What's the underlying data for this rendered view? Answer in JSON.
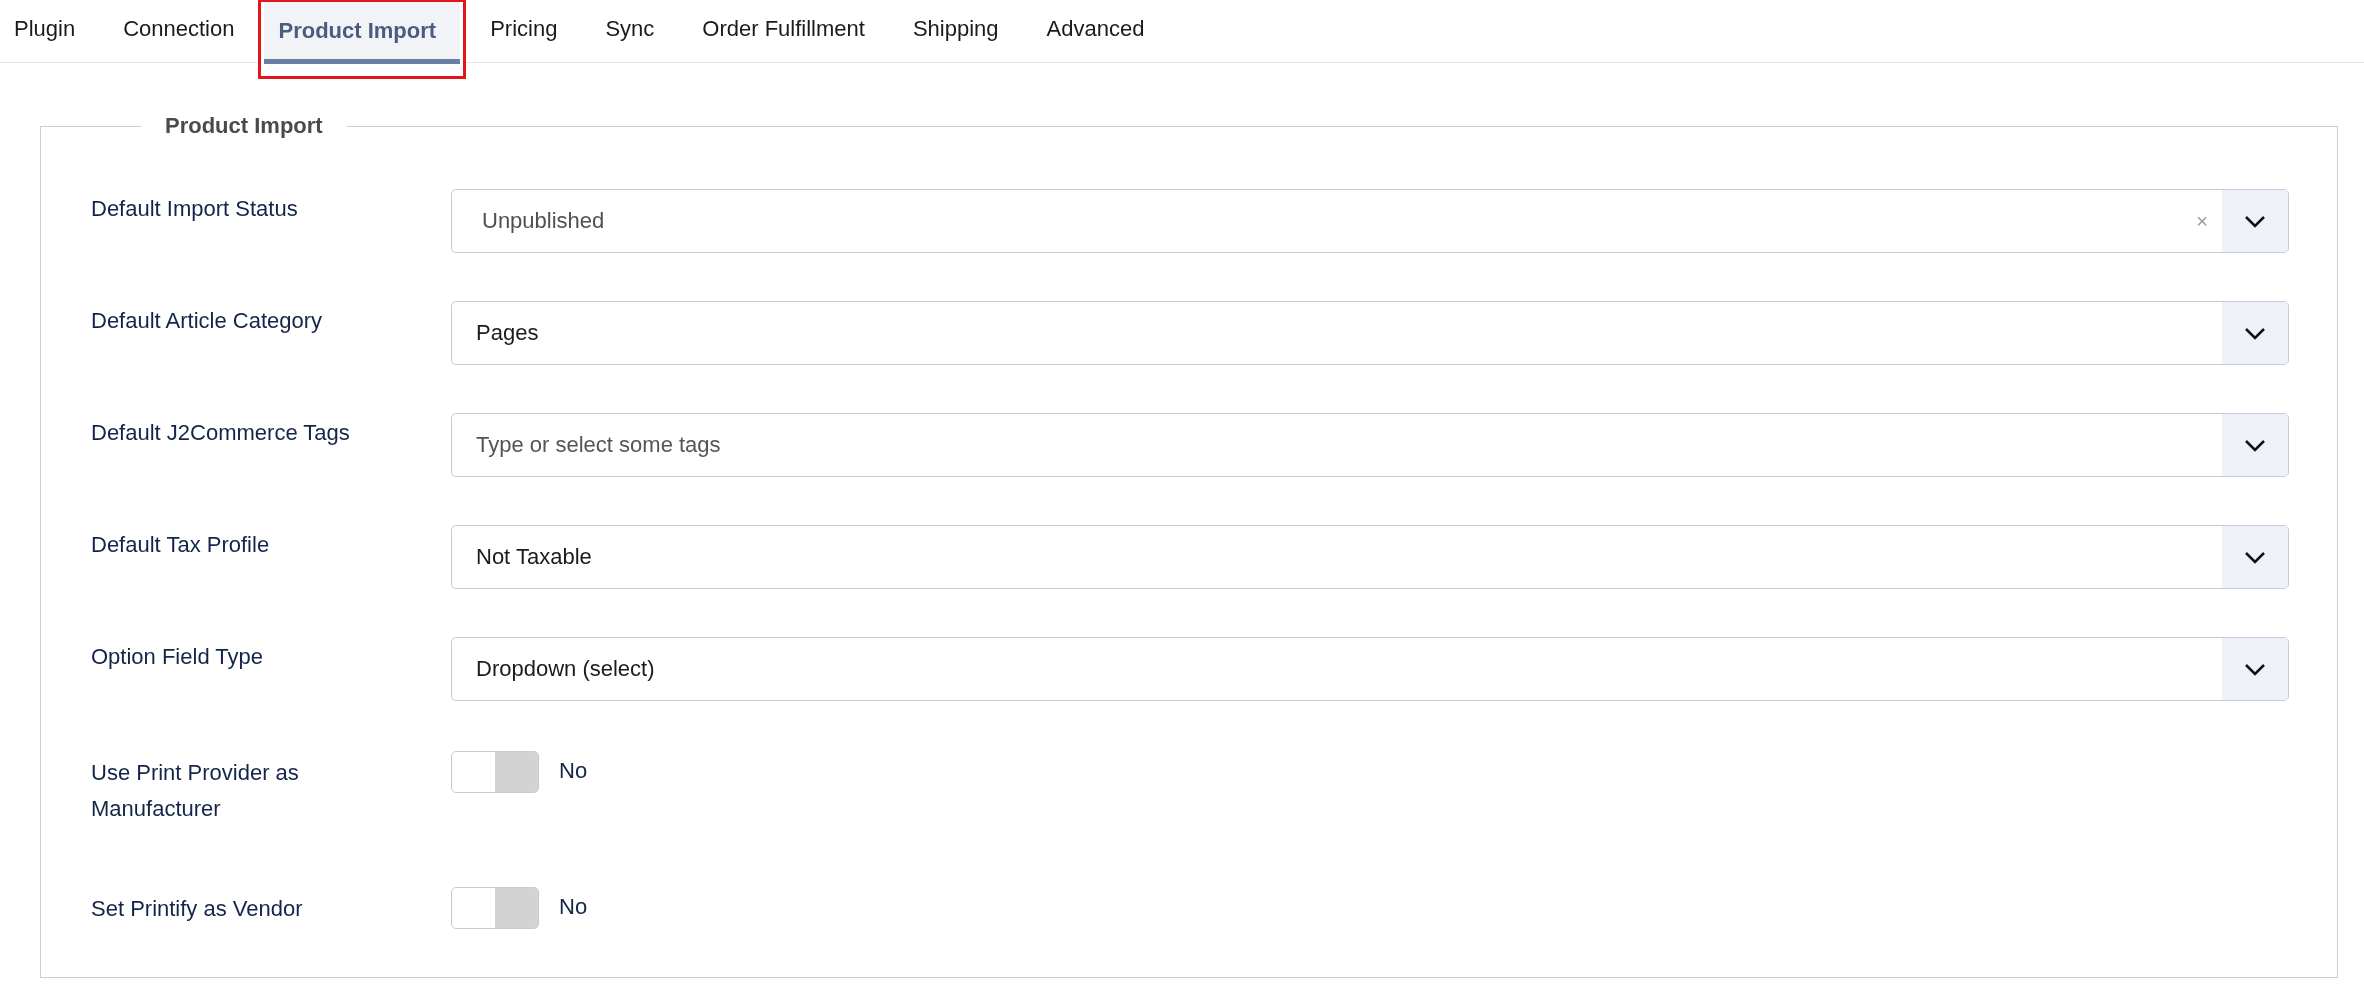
{
  "tabs": [
    {
      "label": "Plugin",
      "selected": false,
      "highlighted": false
    },
    {
      "label": "Connection",
      "selected": false,
      "highlighted": false
    },
    {
      "label": "Product Import",
      "selected": true,
      "highlighted": true
    },
    {
      "label": "Pricing",
      "selected": false,
      "highlighted": false
    },
    {
      "label": "Sync",
      "selected": false,
      "highlighted": false
    },
    {
      "label": "Order Fulfillment",
      "selected": false,
      "highlighted": false
    },
    {
      "label": "Shipping",
      "selected": false,
      "highlighted": false
    },
    {
      "label": "Advanced",
      "selected": false,
      "highlighted": false
    }
  ],
  "section": {
    "legend": "Product Import",
    "fields": [
      {
        "kind": "select",
        "label": "Default Import Status",
        "value": "Unpublished",
        "clear_icon": "×"
      },
      {
        "kind": "select",
        "label": "Default Article Category",
        "value": "Pages"
      },
      {
        "kind": "select",
        "label": "Default J2Commerce Tags",
        "placeholder": "Type or select some tags"
      },
      {
        "kind": "select",
        "label": "Default Tax Profile",
        "value": "Not Taxable"
      },
      {
        "kind": "select",
        "label": "Option Field Type",
        "value": "Dropdown (select)"
      },
      {
        "kind": "toggle",
        "label": "Use Print Provider as Manufacturer",
        "on": false,
        "state_text": "No"
      },
      {
        "kind": "toggle",
        "label": "Set Printify as Vendor",
        "on": false,
        "state_text": "No"
      }
    ]
  }
}
